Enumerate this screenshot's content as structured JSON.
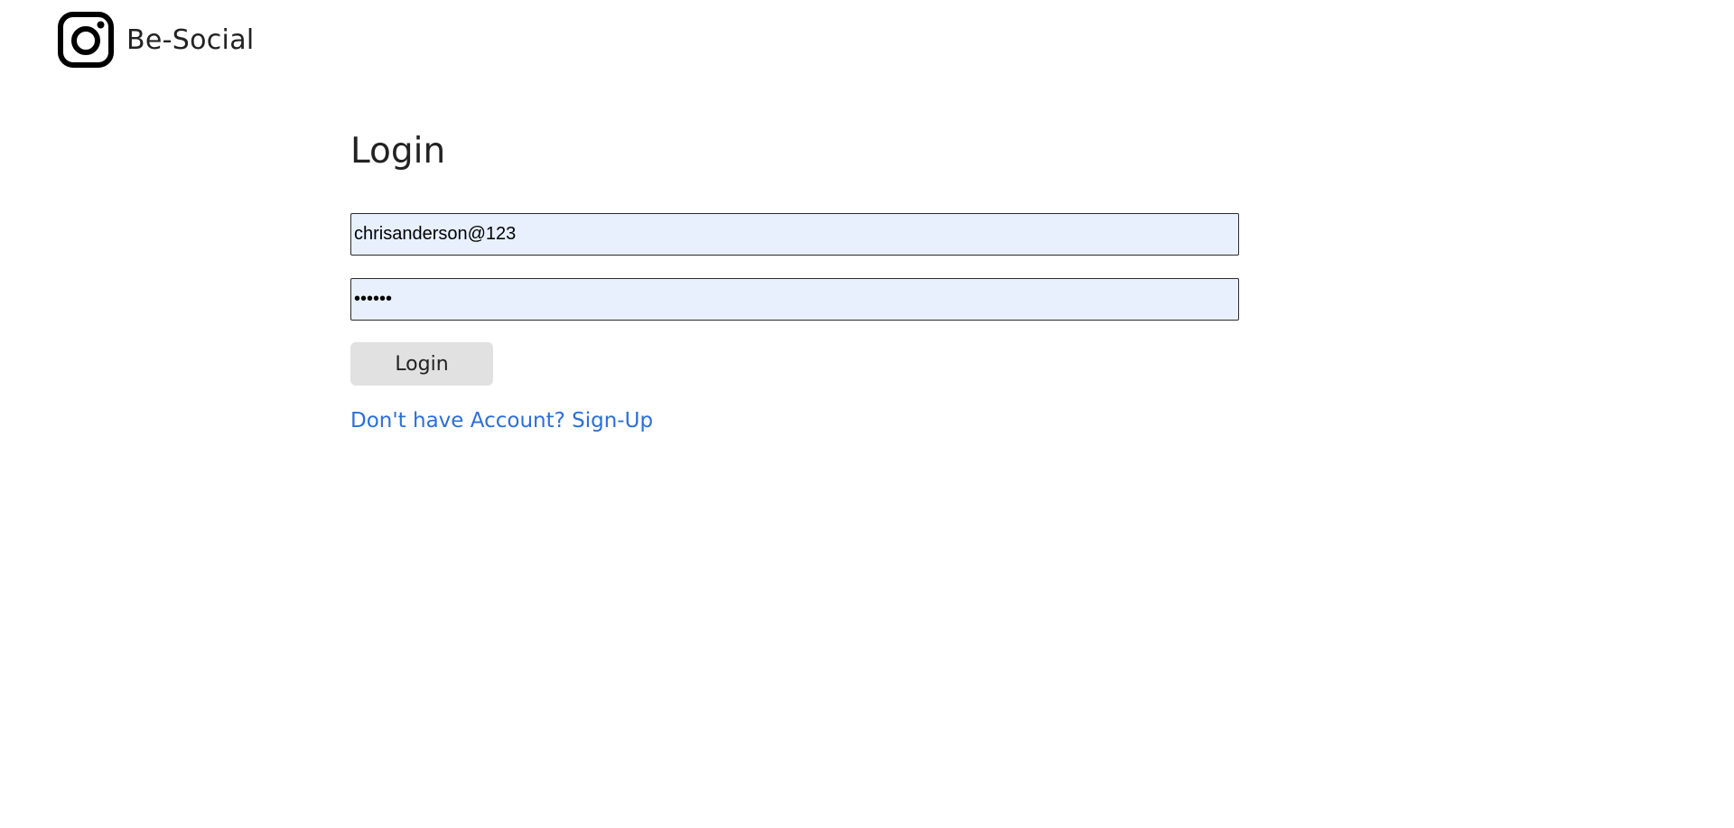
{
  "header": {
    "brand_name": "Be-Social",
    "brand_icon": "instagram-camera-icon"
  },
  "login": {
    "title": "Login",
    "email_value": "chrisanderson@123",
    "password_mask": "••••••",
    "button_label": "Login",
    "signup_link_text": "Don't have Account? Sign-Up"
  },
  "colors": {
    "input_background": "#e8f0fe",
    "link": "#2a6fdb",
    "button_background": "#e1e1e1"
  }
}
